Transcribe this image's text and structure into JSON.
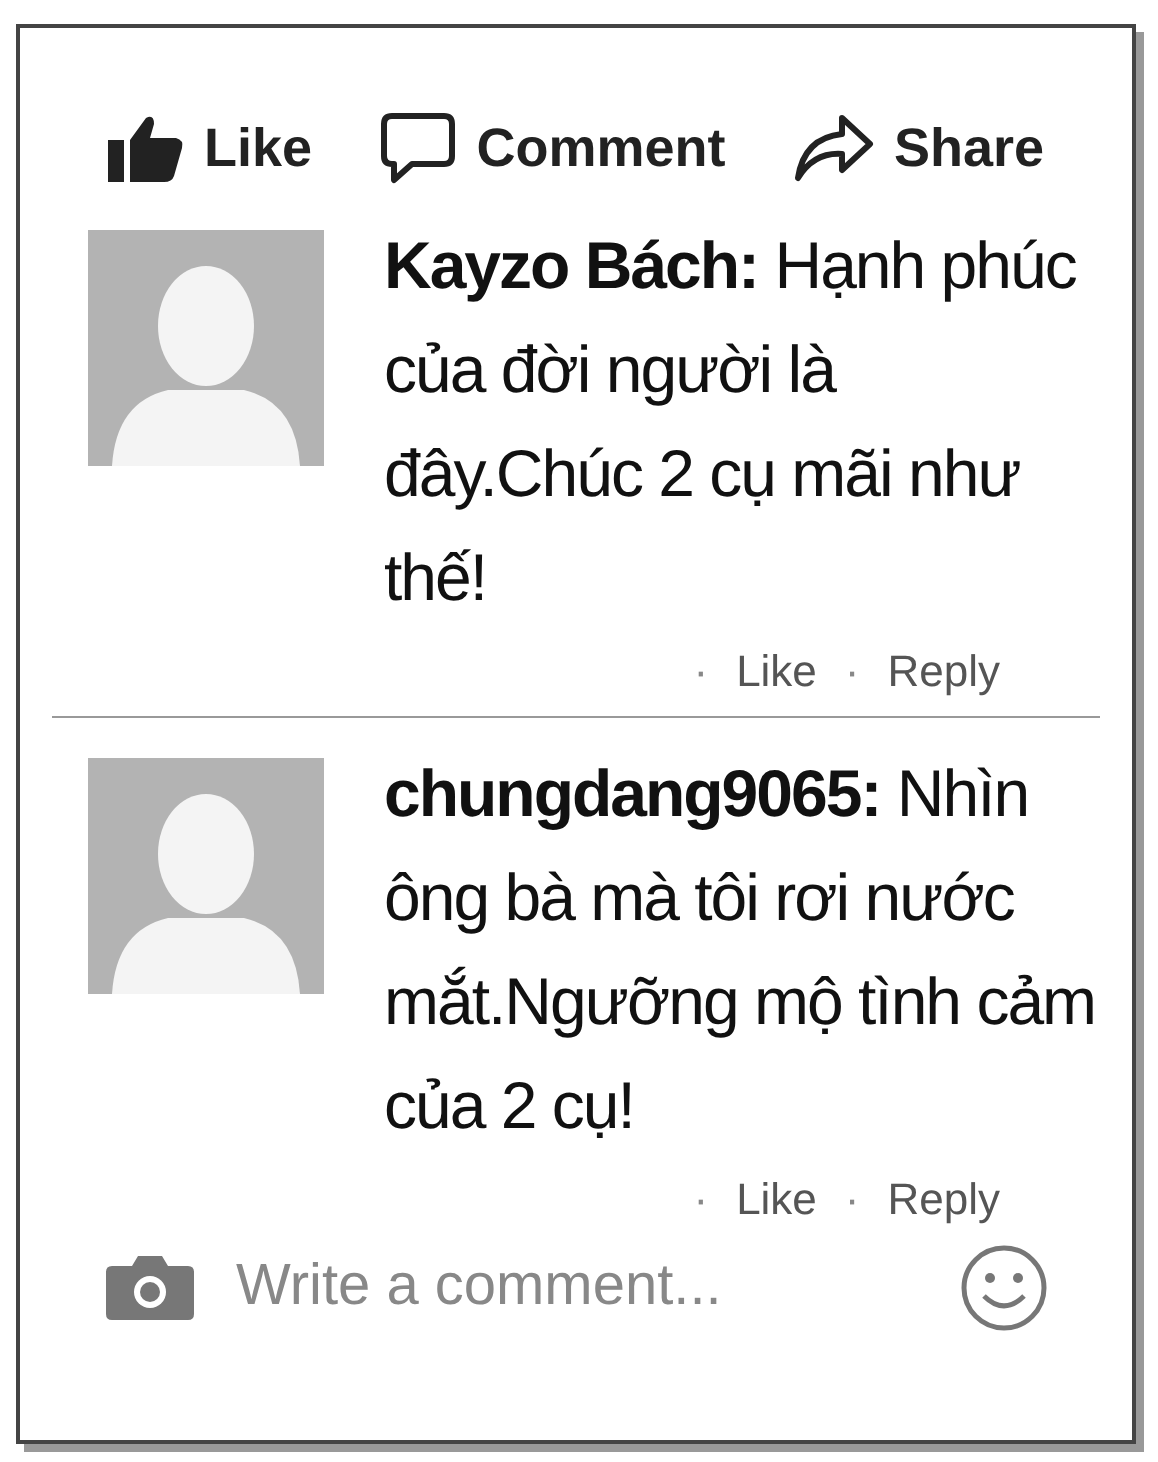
{
  "actions": [
    {
      "label": "Like",
      "kind": "like"
    },
    {
      "label": "Comment",
      "kind": "comment"
    },
    {
      "label": "Share",
      "kind": "share"
    }
  ],
  "comments": [
    {
      "text": "**Kayzo Bách:** Hạnh phúc của đời người là đây.Chúc 2 cụ mãi như thế!",
      "like": "Like",
      "reply": "Reply",
      "separator": "·"
    },
    {
      "text": "**chungdang9065:** Nhìn ông bà mà tôi rơi nước mắt.Ngưỡng mộ tình cảm của 2 cụ!",
      "like": "Like",
      "reply": "Reply",
      "separator": "·"
    }
  ],
  "composer": {
    "placeholder": "Write a comment..."
  }
}
